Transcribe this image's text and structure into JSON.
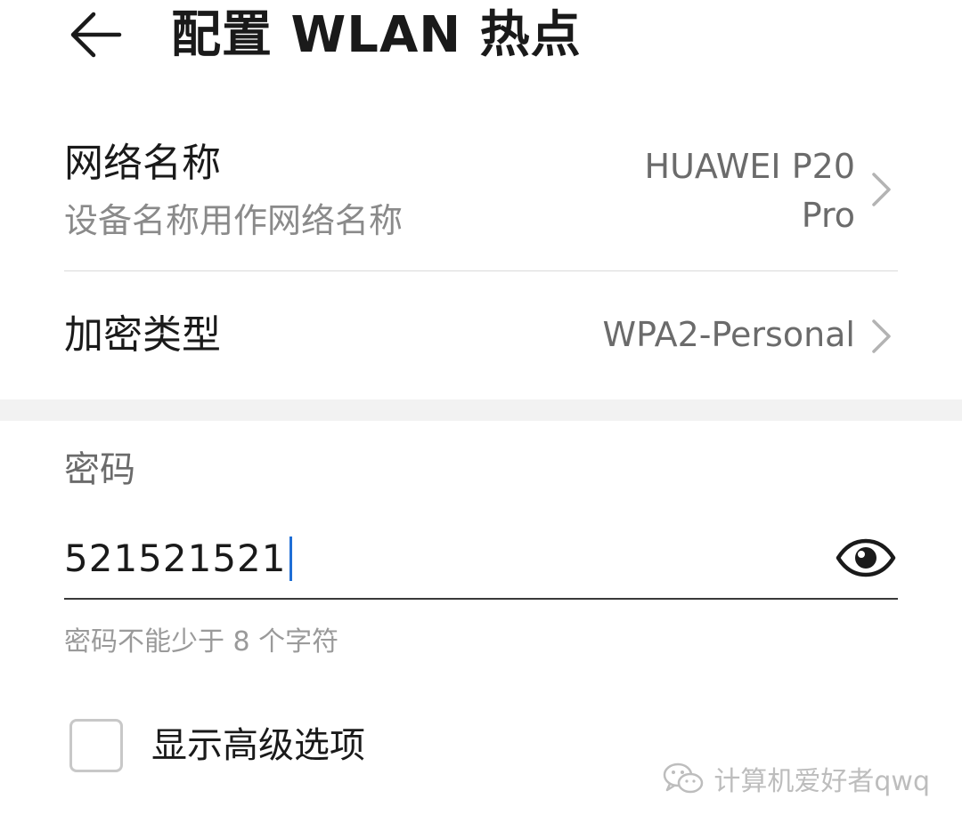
{
  "header": {
    "title": "配置 WLAN 热点",
    "back_icon": "arrow-left-icon"
  },
  "network_name": {
    "title": "网络名称",
    "subtitle": "设备名称用作网络名称",
    "value": "HUAWEI P20 Pro",
    "chevron_icon": "chevron-right-icon"
  },
  "encryption": {
    "title": "加密类型",
    "value": "WPA2-Personal",
    "chevron_icon": "chevron-right-icon"
  },
  "password": {
    "label": "密码",
    "value": "521521521",
    "hint": "密码不能少于 8 个字符",
    "toggle_icon": "eye-icon"
  },
  "advanced": {
    "label": "显示高级选项",
    "checked": false
  },
  "watermark": {
    "text": "计算机爱好者qwq",
    "icon": "wechat-logo-icon"
  },
  "colors": {
    "primary_text": "#1a1a1a",
    "secondary_text": "#6b6b6b",
    "hint_text": "#9a9a9a",
    "caret": "#1f6fd6",
    "divider": "#d9d9d9",
    "section_background": "#f2f2f2"
  }
}
